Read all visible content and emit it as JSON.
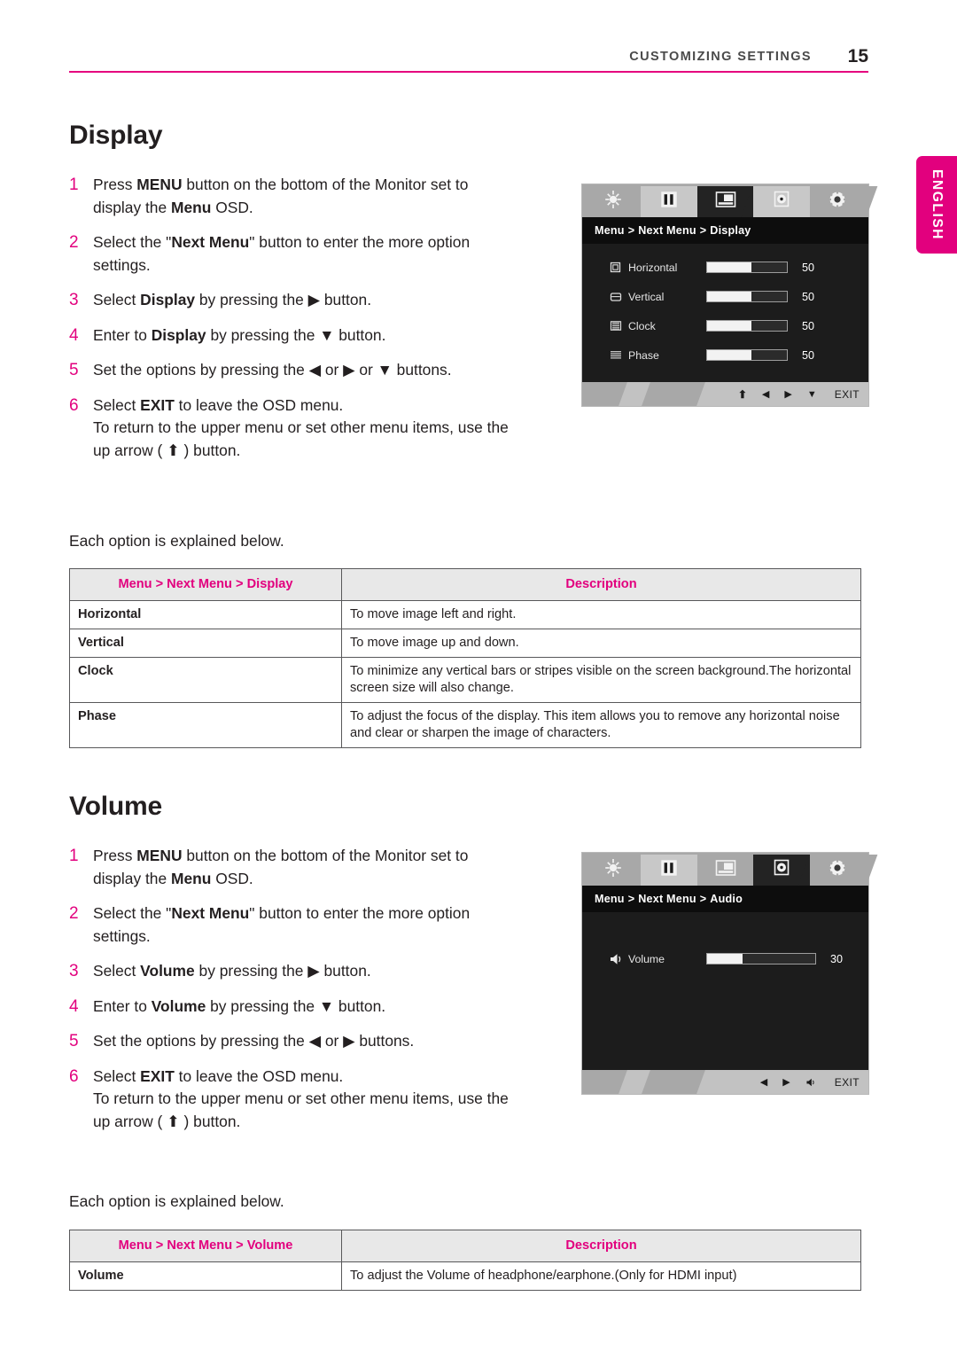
{
  "header": {
    "title": "CUSTOMIZING SETTINGS",
    "page_number": "15"
  },
  "language_tab": {
    "label": "ENGLISH",
    "color": "#e2007e"
  },
  "display_section": {
    "heading": "Display",
    "steps": [
      {
        "num": "1",
        "parts": [
          {
            "t": "Press ",
            "b": false
          },
          {
            "t": "MENU",
            "b": true
          },
          {
            "t": " button on the bottom of the Monitor set to display the ",
            "b": false
          },
          {
            "t": "Menu",
            "b": true
          },
          {
            "t": " OSD.",
            "b": false
          }
        ]
      },
      {
        "num": "2",
        "parts": [
          {
            "t": "Select the \"",
            "b": false
          },
          {
            "t": "Next Menu",
            "b": true
          },
          {
            "t": "\" button to enter the more option settings.",
            "b": false
          }
        ]
      },
      {
        "num": "3",
        "parts": [
          {
            "t": "Select ",
            "b": false
          },
          {
            "t": "Display",
            "b": true
          },
          {
            "t": " by pressing the ▶ button.",
            "b": false
          }
        ]
      },
      {
        "num": "4",
        "parts": [
          {
            "t": "Enter to ",
            "b": false
          },
          {
            "t": "Display",
            "b": true
          },
          {
            "t": " by pressing the ▼ button.",
            "b": false
          }
        ]
      },
      {
        "num": "5",
        "parts": [
          {
            "t": "Set the options by pressing the ◀ or ▶ or ▼ buttons.",
            "b": false
          }
        ]
      },
      {
        "num": "6",
        "parts": [
          {
            "t": "Select ",
            "b": false
          },
          {
            "t": "EXIT",
            "b": true
          },
          {
            "t": " to leave the OSD menu.",
            "b": false
          }
        ],
        "sub": "To return to the upper menu or set other menu items, use the up arrow ( ⬆ ) button."
      }
    ],
    "note": "Each option is explained below.",
    "table": {
      "headers": [
        "Menu > Next Menu > Display",
        "Description"
      ],
      "rows": [
        [
          "Horizontal",
          "To move image left and right."
        ],
        [
          "Vertical",
          "To move image up and down."
        ],
        [
          "Clock",
          "To minimize any vertical bars or stripes visible on the screen background.The horizontal screen size will also change."
        ],
        [
          "Phase",
          "To adjust the focus of the display. This item allows you to remove any horizontal noise and clear or sharpen the image of characters."
        ]
      ]
    },
    "osd": {
      "breadcrumb": [
        "Menu",
        "Next Menu",
        "Display"
      ],
      "active_tab_index": 2,
      "rows": [
        {
          "icon": "horizontal-icon",
          "label": "Horizontal",
          "value": "50",
          "fill_percent": 55
        },
        {
          "icon": "vertical-icon",
          "label": "Vertical",
          "value": "50",
          "fill_percent": 55
        },
        {
          "icon": "clock-icon",
          "label": "Clock",
          "value": "50",
          "fill_percent": 55
        },
        {
          "icon": "phase-icon",
          "label": "Phase",
          "value": "50",
          "fill_percent": 55
        }
      ],
      "footer": [
        "⬆",
        "◀",
        "▶",
        "▼"
      ],
      "exit_label": "EXIT"
    }
  },
  "volume_section": {
    "heading": "Volume",
    "steps": [
      {
        "num": "1",
        "parts": [
          {
            "t": "Press ",
            "b": false
          },
          {
            "t": "MENU",
            "b": true
          },
          {
            "t": " button on the bottom of the Monitor set to display the ",
            "b": false
          },
          {
            "t": "Menu",
            "b": true
          },
          {
            "t": " OSD.",
            "b": false
          }
        ]
      },
      {
        "num": "2",
        "parts": [
          {
            "t": "Select the \"",
            "b": false
          },
          {
            "t": "Next Menu",
            "b": true
          },
          {
            "t": "\" button to enter the more option settings.",
            "b": false
          }
        ]
      },
      {
        "num": "3",
        "parts": [
          {
            "t": "Select ",
            "b": false
          },
          {
            "t": "Volume",
            "b": true
          },
          {
            "t": " by pressing the ▶ button.",
            "b": false
          }
        ]
      },
      {
        "num": "4",
        "parts": [
          {
            "t": "Enter to ",
            "b": false
          },
          {
            "t": "Volume",
            "b": true
          },
          {
            "t": " by pressing the ▼ button.",
            "b": false
          }
        ]
      },
      {
        "num": "5",
        "parts": [
          {
            "t": "Set the options by pressing the ◀ or ▶ buttons.",
            "b": false
          }
        ]
      },
      {
        "num": "6",
        "parts": [
          {
            "t": "Select ",
            "b": false
          },
          {
            "t": "EXIT",
            "b": true
          },
          {
            "t": " to leave the OSD menu.",
            "b": false
          }
        ],
        "sub": "To return to the upper menu or set other menu items, use the up arrow ( ⬆ ) button."
      }
    ],
    "note": "Each option is explained below.",
    "table": {
      "headers": [
        "Menu > Next Menu > Volume",
        "Description"
      ],
      "rows": [
        [
          "Volume",
          "To adjust the Volume of headphone/earphone.(Only for HDMI input)"
        ]
      ]
    },
    "osd": {
      "breadcrumb": [
        "Menu",
        "Next Menu",
        "Audio"
      ],
      "active_tab_index": 3,
      "rows": [
        {
          "icon": "speaker-icon",
          "label": "Volume",
          "value": "30",
          "fill_percent": 33
        }
      ],
      "footer": [
        "◀",
        "▶",
        "speaker"
      ],
      "exit_label": "EXIT"
    }
  }
}
